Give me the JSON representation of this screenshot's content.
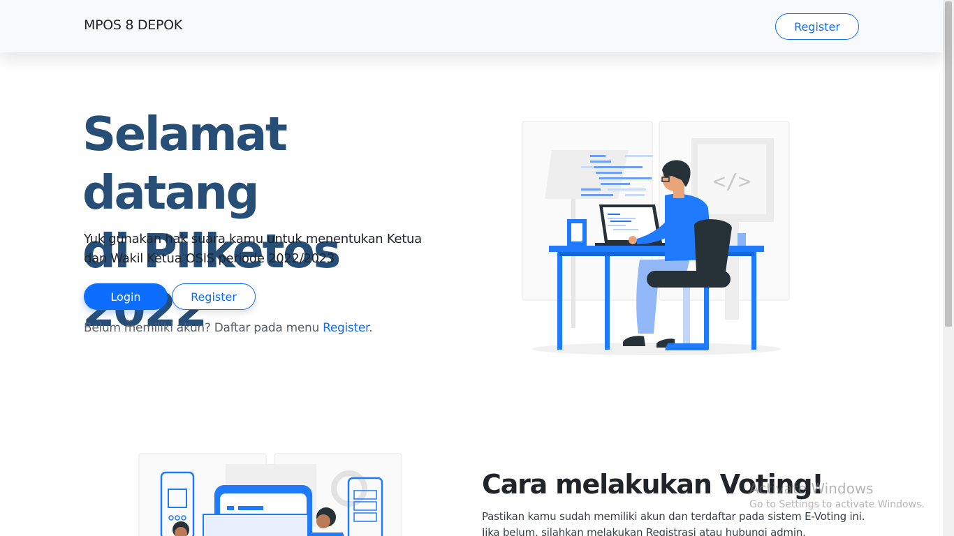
{
  "navbar": {
    "brand": "MPOS 8 DEPOK",
    "register_label": "Register"
  },
  "hero": {
    "title_line1": "Selamat datang",
    "title_line2": "di Pilketos 2022",
    "subtitle": "Yuk gunakan hak suara kamu untuk menentukan Ketua dan Wakil Ketua OSIS periode 2022/2023",
    "login_label": "Login",
    "register_label": "Register",
    "note_text": "Belum memiliki akun? Daftar pada menu ",
    "note_link": "Register",
    "note_suffix": "."
  },
  "section2": {
    "title": "Cara melakukan Voting!",
    "text": "Pastikan kamu sudah memiliki akun dan terdaftar pada sistem E-Voting ini. Jika belum, silahkan melakukan Registrasi atau hubungi admin."
  },
  "watermark": {
    "line1": "Activate Windows",
    "line2": "Go to Settings to activate Windows."
  },
  "illustration": {
    "code_sign": "</>"
  },
  "colors": {
    "primary": "#0d6efd",
    "heading": "#264e76",
    "illustration_blue": "#1f7afc",
    "dark": "#263238"
  }
}
